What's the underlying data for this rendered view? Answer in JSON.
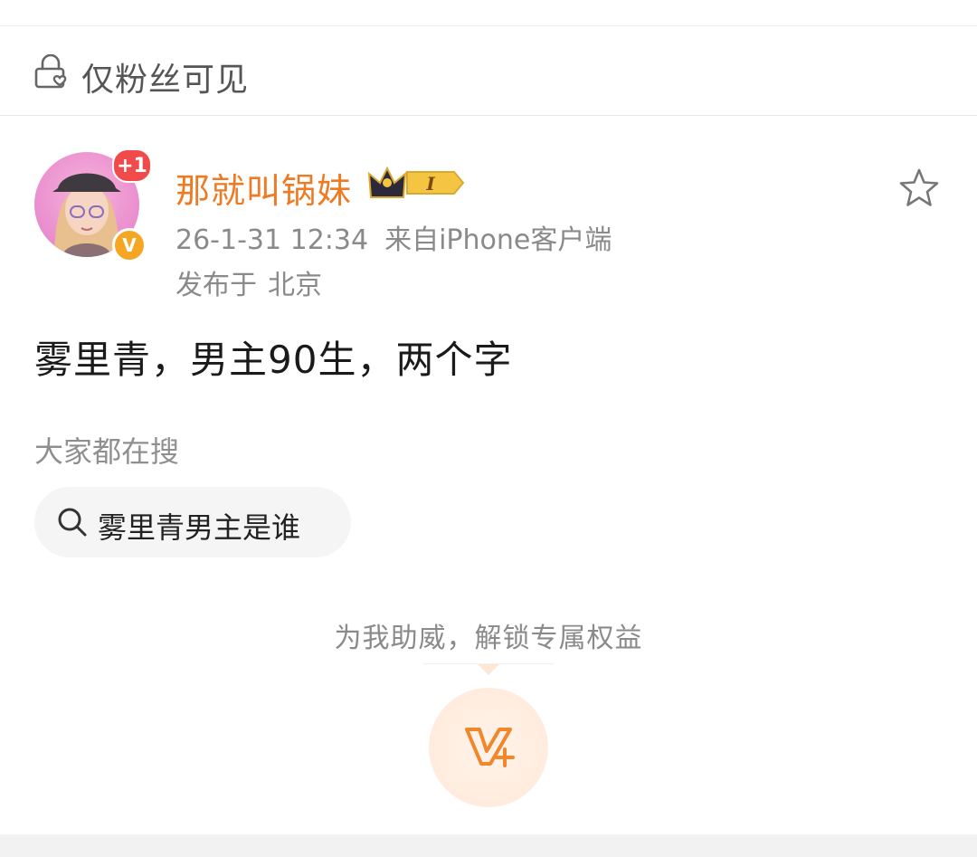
{
  "visibility": {
    "label": "仅粉丝可见",
    "icon": "lock-heart-icon"
  },
  "author": {
    "name": "那就叫锅妹",
    "follow_badge": "+1",
    "verified_badge": "V",
    "vip_badge_letter": "I",
    "avatar_icon": "avatar-girl-icon",
    "vip_icon": "crown-icon"
  },
  "post_meta": {
    "time": "26-1-31 12:34",
    "source": "来自iPhone客户端",
    "location_prefix": "发布于",
    "location": "北京"
  },
  "post": {
    "text": "雾里青，男主90生，两个字"
  },
  "hot_search": {
    "heading": "大家都在搜",
    "query": "雾里青男主是谁",
    "icon": "search-icon"
  },
  "support": {
    "text": "为我助威，解锁专属权益",
    "icon": "v-plus-icon"
  },
  "actions": {
    "favorite_icon": "star-icon"
  },
  "colors": {
    "username": "#ee7a23",
    "accent_orange": "#f0882b",
    "badge_red": "#f04a4a",
    "meta_gray": "#8a8a8a"
  }
}
